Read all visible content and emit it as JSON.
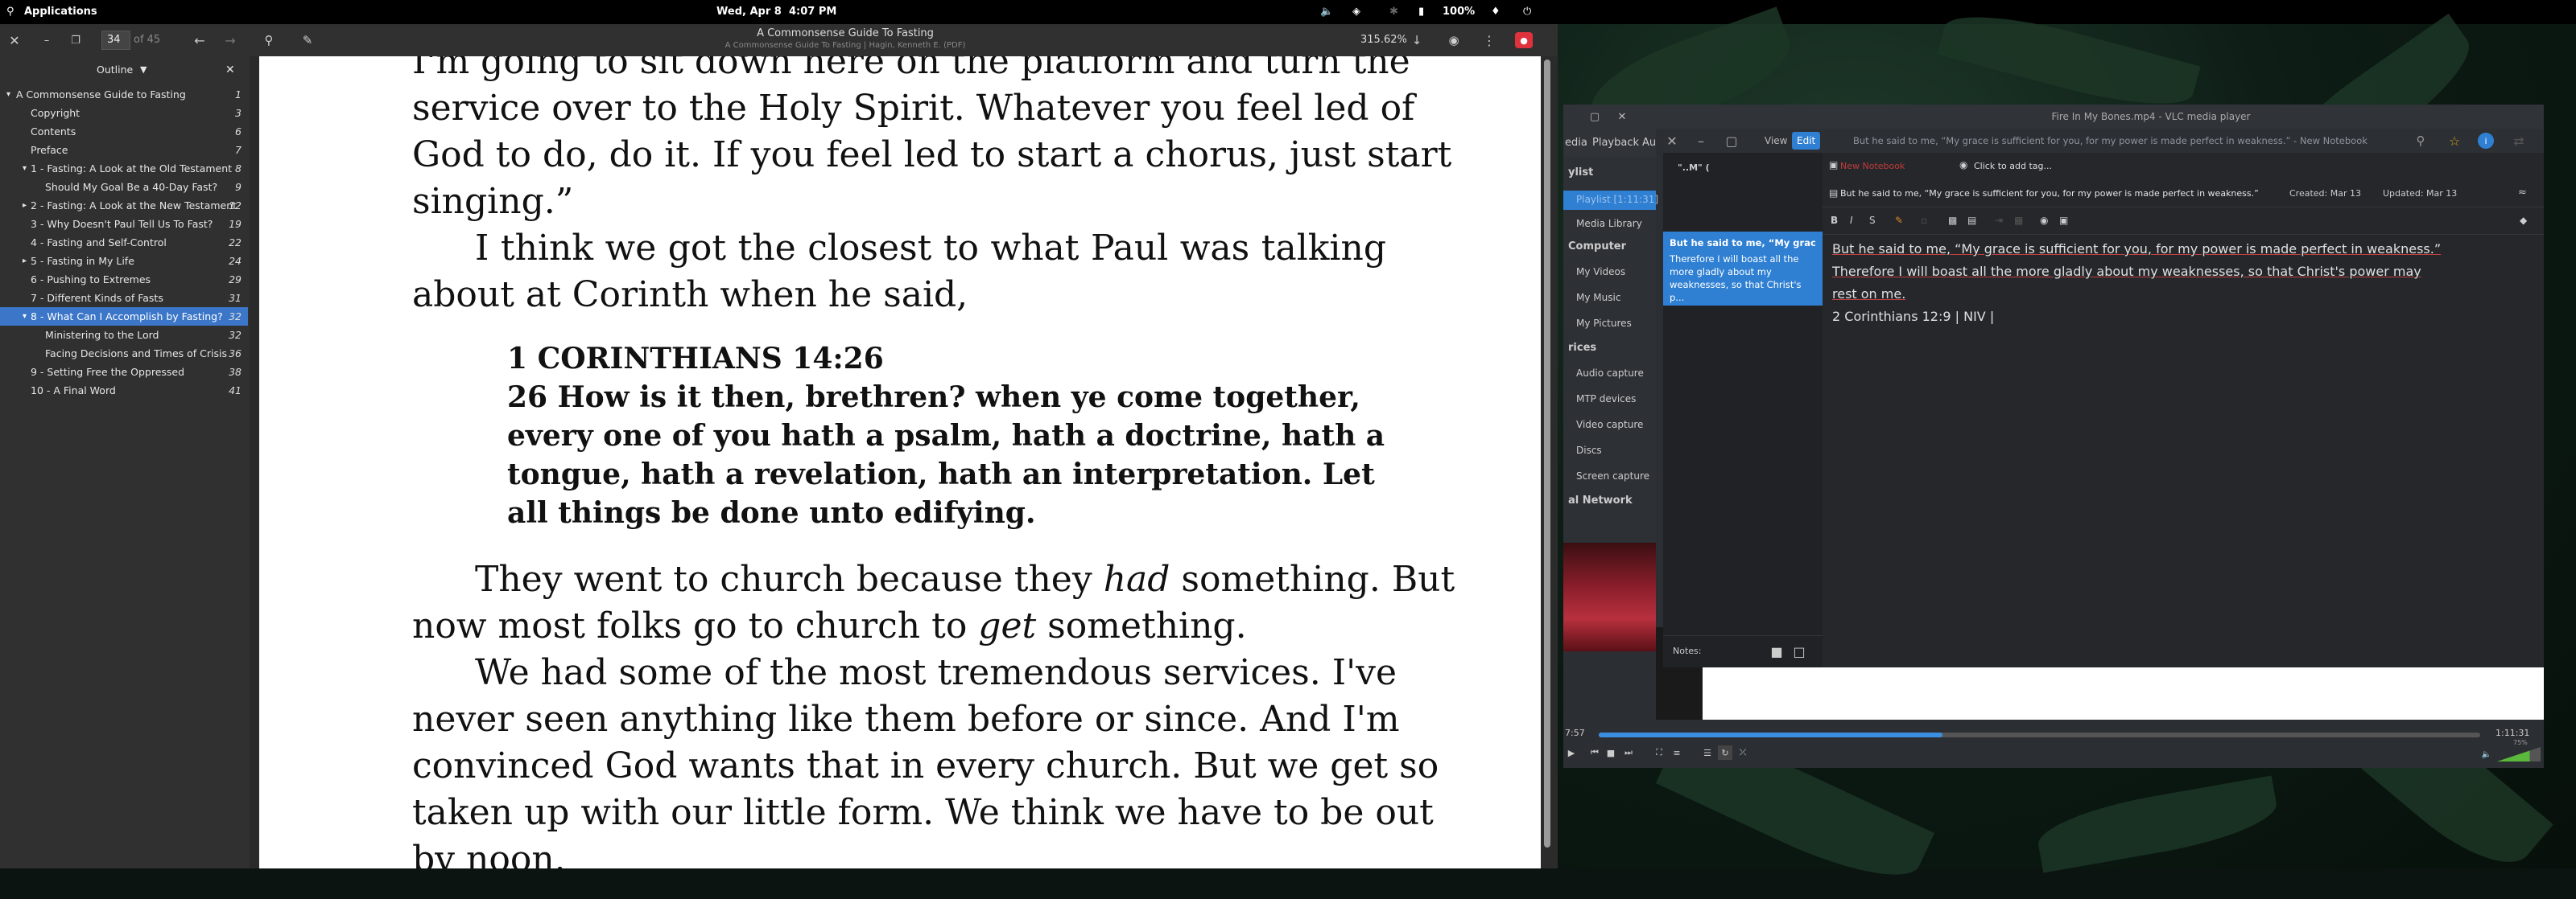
{
  "topbar": {
    "applications": "Applications",
    "date": "Wed, Apr 8",
    "time": "4:07 PM",
    "battery": "100%"
  },
  "reader": {
    "page_number": "34",
    "page_total": "of 45",
    "title": "A Commonsense Guide To Fasting",
    "subtitle": "A Commonsense Guide To Fasting | Hagin, Kenneth E. (PDF)",
    "zoom": "315.62%",
    "outline_label": "Outline",
    "outline": [
      {
        "label": "A Commonsense Guide to Fasting",
        "page": "1",
        "indent": 0,
        "arrow": "▾"
      },
      {
        "label": "Copyright",
        "page": "3",
        "indent": 1,
        "arrow": ""
      },
      {
        "label": "Contents",
        "page": "6",
        "indent": 1,
        "arrow": ""
      },
      {
        "label": "Preface",
        "page": "7",
        "indent": 1,
        "arrow": ""
      },
      {
        "label": "1 - Fasting: A Look at the Old Testament",
        "page": "8",
        "indent": 1,
        "arrow": "▾"
      },
      {
        "label": "Should My Goal Be a 40-Day Fast?",
        "page": "9",
        "indent": 2,
        "arrow": ""
      },
      {
        "label": "2 - Fasting: A Look at the New Testament",
        "page": "12",
        "indent": 1,
        "arrow": "▸"
      },
      {
        "label": "3 - Why Doesn't Paul Tell Us To Fast?",
        "page": "19",
        "indent": 1,
        "arrow": ""
      },
      {
        "label": "4 - Fasting and Self-Control",
        "page": "22",
        "indent": 1,
        "arrow": ""
      },
      {
        "label": "5 - Fasting in My Life",
        "page": "24",
        "indent": 1,
        "arrow": "▸"
      },
      {
        "label": "6 - Pushing to Extremes",
        "page": "29",
        "indent": 1,
        "arrow": ""
      },
      {
        "label": "7 - Different Kinds of Fasts",
        "page": "31",
        "indent": 1,
        "arrow": ""
      },
      {
        "label": "8 - What Can I Accomplish by Fasting?",
        "page": "32",
        "indent": 1,
        "arrow": "▾",
        "selected": true
      },
      {
        "label": "Ministering to the Lord",
        "page": "32",
        "indent": 2,
        "arrow": ""
      },
      {
        "label": "Facing Decisions and Times of Crisis",
        "page": "36",
        "indent": 2,
        "arrow": ""
      },
      {
        "label": "9 - Setting Free the Oppressed",
        "page": "38",
        "indent": 1,
        "arrow": ""
      },
      {
        "label": "10 - A Final Word",
        "page": "41",
        "indent": 1,
        "arrow": ""
      }
    ],
    "body": {
      "l1": "I'm going to sit down here on the platform and turn the",
      "l2": "service over to the Holy Spirit. Whatever you feel led of",
      "l3": "God to do, do it. If you feel led to start a chorus, just start",
      "l4": "singing.”",
      "l5": "I think we got the closest to what Paul was talking",
      "l6": "about at Corinth when he said,",
      "verse_ref": "1 CORINTHIANS 14:26",
      "v1": "26 How is it then, brethren? when ye come together,",
      "v2": "every one of you hath a psalm, hath a doctrine, hath a",
      "v3": "tongue, hath a revelation, hath an interpretation. Let",
      "v4": "all things be done unto edifying.",
      "l7a": "They went to church because they ",
      "l7b": "had",
      "l7c": " something. But",
      "l8a": "now most folks go to church to ",
      "l8b": "get",
      "l8c": " something.",
      "l9": "We had some of the most tremendous services. I've",
      "l10": "never seen anything like them before or since. And I'm",
      "l11": "convinced God wants that in every church. But we get so",
      "l12": "taken up with our little form. We think we have to be out",
      "l13": "by noon."
    }
  },
  "vlc": {
    "title": "Fire In My Bones.mp4 - VLC media player",
    "menu": [
      "edia",
      "Playback",
      "Au"
    ],
    "sidebar": {
      "playlist_header": "ylist",
      "playlist": "Playlist [1:11:31]",
      "media_library": "Media Library",
      "computer_header": "Computer",
      "my_videos": "My Videos",
      "my_music": "My Music",
      "my_pictures": "My Pictures",
      "devices_header": "rices",
      "audio_capture": "Audio capture",
      "mtp_devices": "MTP devices",
      "video_capture": "Video capture",
      "discs": "Discs",
      "screen_capture": "Screen capture",
      "network_header": "al Network"
    },
    "elapsed": "7:57",
    "duration": "1:11:31",
    "progress": 0.39,
    "volume": "75%"
  },
  "notebook": {
    "title": "But he said to me, “My grace is sufficient for you, for my power is made perfect in weakness.” - New Notebook",
    "menu_view": "View",
    "menu_edit": "Edit",
    "list_header": "\"..M\" (",
    "card_title": "But he said to me, “My grace i...",
    "card_preview": "Therefore I will boast all the more gladly about my weaknesses, so that Christ's p...",
    "notes_label": "Notes:",
    "notebook_name": "New Notebook",
    "tag_placeholder": "Click to add tag...",
    "note_title": "But he said to me, “My grace is sufficient for you, for my power is made perfect in weakness.”",
    "created": "Created: Mar 13",
    "updated": "Updated: Mar 13",
    "line1a": "But he said to me, ",
    "line1b": "“My grace is sufficient for you, for my power is made perfect in weakness.”",
    "line2": "Therefore I will boast all the more gladly about my weaknesses, so that Christ's power may",
    "line3": "rest on me.",
    "line4": "2 Corinthians 12:9 | NIV |"
  },
  "colors": {
    "accent": "#3b76c8",
    "card": "#2f7fd2",
    "record": "#e0323c"
  }
}
